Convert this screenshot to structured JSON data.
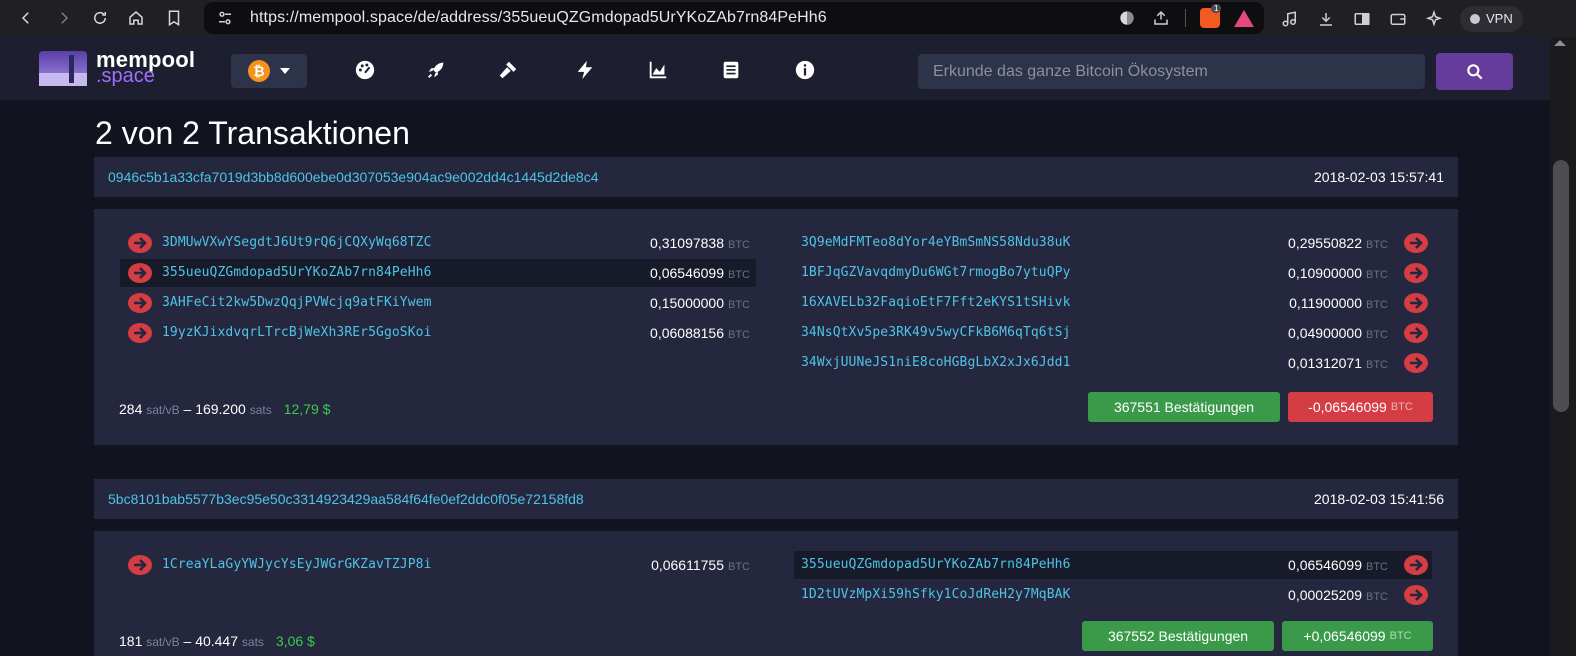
{
  "browser": {
    "url": "https://mempool.space/de/address/355ueuQZGmdopad5UrYKoZAb7rn84PeHh6",
    "brave_badge": "1",
    "vpn_label": "VPN"
  },
  "site": {
    "logo_top": "mempool",
    "logo_bottom": ".space",
    "coin_symbol": "₿",
    "search_placeholder": "Erkunde das ganze Bitcoin Ökosystem"
  },
  "page": {
    "title": "2 von 2 Transaktionen"
  },
  "unit": "BTC",
  "transactions": [
    {
      "txid": "0946c5b1a33cfa7019d3bb8d600ebe0d307053e904ac9e002dd4c1445d2de8c4",
      "time": "2018-02-03 15:57:41",
      "inputs": [
        {
          "address": "3DMUwVXwYSegdtJ6Ut9rQ6jCQXyWq68TZC",
          "amount": "0,31097838"
        },
        {
          "address": "355ueuQZGmdopad5UrYKoZAb7rn84PeHh6",
          "amount": "0,06546099"
        },
        {
          "address": "3AHFeCit2kw5DwzQqjPVWcjq9atFKiYwem",
          "amount": "0,15000000"
        },
        {
          "address": "19yzKJixdvqrLTrcBjWeXh3REr5GgoSKoi",
          "amount": "0,06088156"
        }
      ],
      "outputs": [
        {
          "address": "3Q9eMdFMTeo8dYor4eYBmSmNS58Ndu38uK",
          "amount": "0,29550822"
        },
        {
          "address": "1BFJqGZVavqdmyDu6WGt7rmogBo7ytuQPy",
          "amount": "0,10900000"
        },
        {
          "address": "16XAVELb32FaqioEtF7Fft2eKYS1tSHivk",
          "amount": "0,11900000"
        },
        {
          "address": "34NsQtXv5pe3RK49v5wyCFkB6M6qTq6tSj",
          "amount": "0,04900000"
        },
        {
          "address": "34WxjUUNeJS1niE8coHGBgLbX2xJx6Jdd1",
          "amount": "0,01312071"
        }
      ],
      "fee_rate": "284",
      "fee_rate_unit": "sat/vB",
      "dash": "–",
      "fee": "169.200",
      "fee_unit": "sats",
      "fee_usd": "12,79 $",
      "confirmations": "367551 Bestätigungen",
      "delta": "-0,06546099"
    },
    {
      "txid": "5bc8101bab5577b3ec95e50c3314923429aa584f64fe0ef2ddc0f05e72158fd8",
      "time": "2018-02-03 15:41:56",
      "inputs": [
        {
          "address": "1CreaYLaGyYWJycYsEyJWGrGKZavTZJP8i",
          "amount": "0,06611755"
        }
      ],
      "outputs": [
        {
          "address": "355ueuQZGmdopad5UrYKoZAb7rn84PeHh6",
          "amount": "0,06546099"
        },
        {
          "address": "1D2tUVzMpXi59hSfky1CoJdReH2y7MqBAK",
          "amount": "0,00025209"
        }
      ],
      "fee_rate": "181",
      "fee_rate_unit": "sat/vB",
      "dash": "–",
      "fee": "40.447",
      "fee_unit": "sats",
      "fee_usd": "3,06 $",
      "confirmations": "367552 Bestätigungen",
      "delta": "+0,06546099"
    }
  ],
  "colors": {
    "accent_link": "#4fc3e6",
    "positive": "#3a9a4a",
    "negative": "#d43d43",
    "arrow": "#d43d43"
  }
}
